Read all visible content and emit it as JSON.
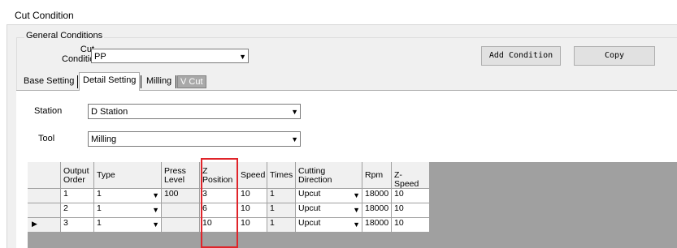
{
  "window": {
    "title": "Cut Condition"
  },
  "general": {
    "group_label": "General Conditions",
    "cut_condition_label_line1": "Cut",
    "cut_condition_label_line2": "Condition",
    "cut_condition_value": "PP",
    "add_condition_label": "Add Condition",
    "copy_label": "Copy"
  },
  "tabs": [
    {
      "label": "Base Setting",
      "selected": false
    },
    {
      "label": "Detail Setting",
      "selected": true
    },
    {
      "label": "Milling",
      "selected": false
    },
    {
      "label": "V Cut",
      "selected": false
    }
  ],
  "detail": {
    "station_label": "Station",
    "station_value": "D Station",
    "tool_label": "Tool",
    "tool_value": "Milling"
  },
  "grid": {
    "headers": {
      "output_order": [
        "Output",
        "Order"
      ],
      "type": "Type",
      "press_level": [
        "Press",
        "Level"
      ],
      "z_position": [
        "Z",
        "Position"
      ],
      "speed": "Speed",
      "times": "Times",
      "cutting_direction": [
        "Cutting",
        "Direction"
      ],
      "rpm": "Rpm",
      "z_speed": "Z-Speed"
    },
    "current_row_marker": "▶",
    "rows": [
      {
        "output_order": "1",
        "type": "1",
        "press_level": "100",
        "z_position": "3",
        "speed": "10",
        "times": "1",
        "cutting_direction": "Upcut",
        "rpm": "18000",
        "z_speed": "10"
      },
      {
        "output_order": "2",
        "type": "1",
        "press_level": "",
        "z_position": "6",
        "speed": "10",
        "times": "1",
        "cutting_direction": "Upcut",
        "rpm": "18000",
        "z_speed": "10"
      },
      {
        "output_order": "3",
        "type": "1",
        "press_level": "",
        "z_position": "10",
        "speed": "10",
        "times": "1",
        "cutting_direction": "Upcut",
        "rpm": "18000",
        "z_speed": "10"
      }
    ]
  },
  "colors": {
    "highlight_box": "#e0242a",
    "vcut_tab_bg": "#a9a9a9"
  },
  "icons": {
    "dropdown": "chevron-down-icon",
    "row_indicator": "triangle-right-icon"
  }
}
